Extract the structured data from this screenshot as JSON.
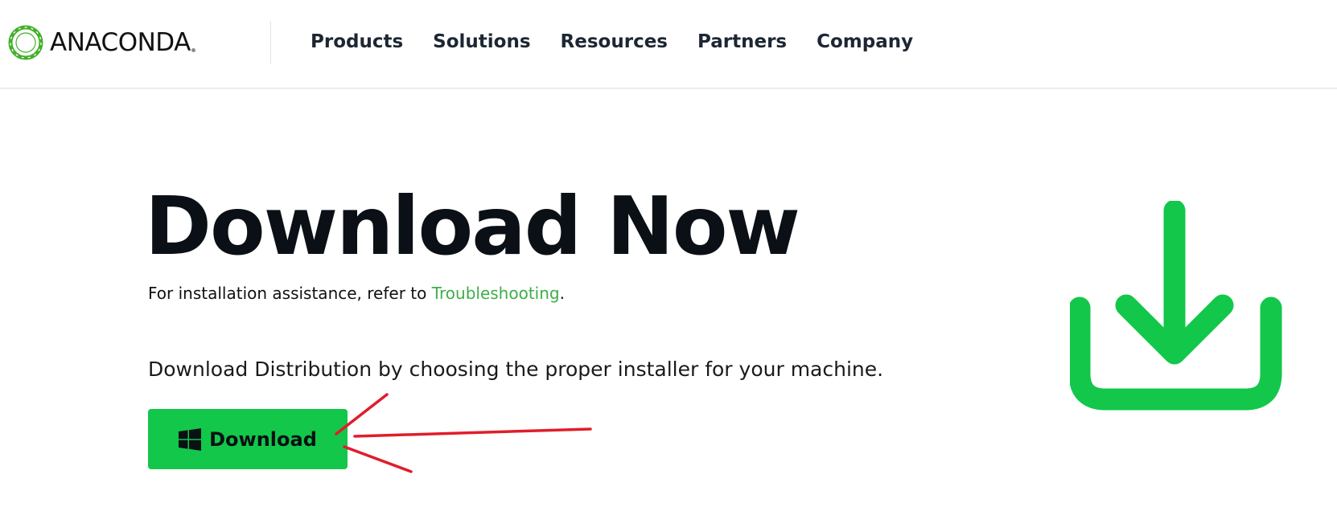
{
  "header": {
    "logo_text": "ANACONDA",
    "nav": [
      {
        "label": "Products"
      },
      {
        "label": "Solutions"
      },
      {
        "label": "Resources"
      },
      {
        "label": "Partners"
      },
      {
        "label": "Company"
      }
    ]
  },
  "hero": {
    "title": "Download Now",
    "assist_prefix": "For installation assistance, refer to ",
    "assist_link": "Troubleshooting",
    "assist_suffix": ".",
    "choose_text": "Download Distribution by choosing the proper installer for your machine.",
    "download_label": "Download",
    "download_icon": "windows-icon",
    "big_icon": "download-icon"
  },
  "colors": {
    "brand_green": "#12c74a",
    "link_green": "#3fae49",
    "annotation_red": "#e11d2a"
  }
}
